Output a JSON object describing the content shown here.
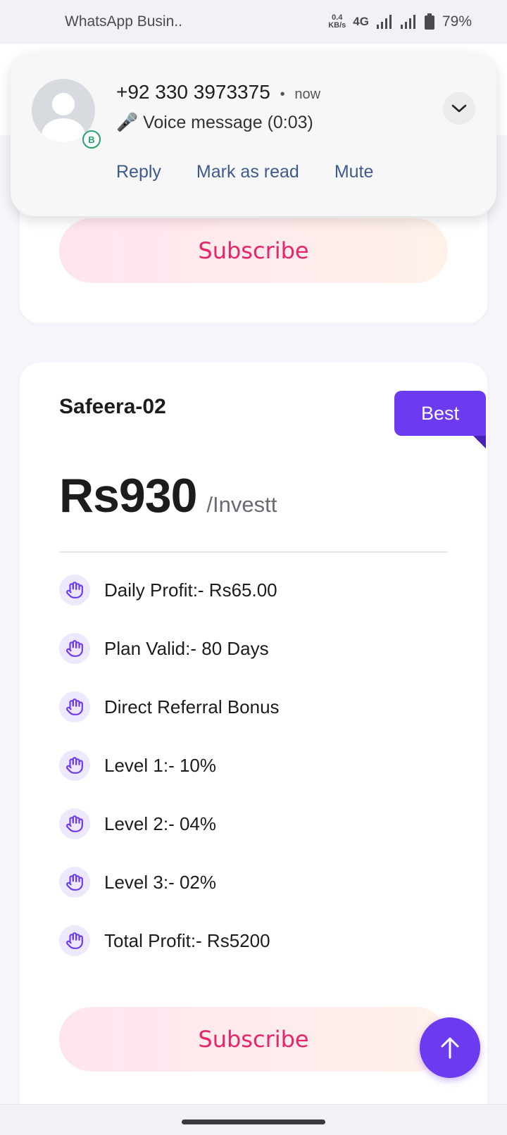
{
  "status_bar": {
    "app_name": "WhatsApp Busin..",
    "speed_value": "0.4",
    "speed_unit": "KB/s",
    "network": "4G",
    "battery": "79%"
  },
  "notification": {
    "sender": "+92 330 3973375",
    "separator": "•",
    "time": "now",
    "message": "🎤 Voice message (0:03)",
    "badge_letter": "B",
    "actions": [
      "Reply",
      "Mark as read",
      "Mute"
    ]
  },
  "card1": {
    "subscribe_label": "Subscribe"
  },
  "plan": {
    "name": "Safeera-02",
    "badge": "Best",
    "price": "Rs930",
    "per": "/Investt",
    "features": [
      "Daily Profit:- Rs65.00",
      "Plan Valid:- 80 Days",
      "Direct Referral Bonus",
      "Level 1:- 10%",
      "Level 2:- 04%",
      "Level 3:- 02%",
      "Total Profit:- Rs5200"
    ],
    "subscribe_label": "Subscribe"
  },
  "colors": {
    "accent": "#6c3aef",
    "subscribe_text": "#e8246b",
    "action_text": "#3e5a8f"
  }
}
